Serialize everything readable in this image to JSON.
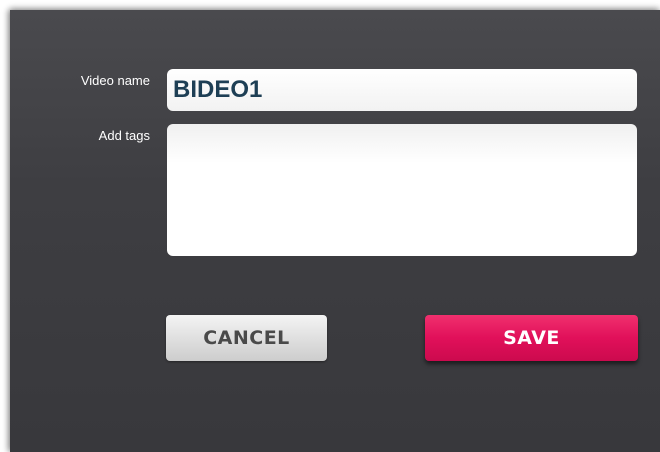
{
  "form": {
    "video_name_label": "Video name",
    "video_name_value": "BIDEO1",
    "tags_label": "Add tags",
    "tags_value": ""
  },
  "buttons": {
    "cancel_label": "CANCEL",
    "save_label": "SAVE"
  },
  "colors": {
    "background": "#3e3e42",
    "save_accent": "#e1105a",
    "name_text": "#1e3f55"
  }
}
